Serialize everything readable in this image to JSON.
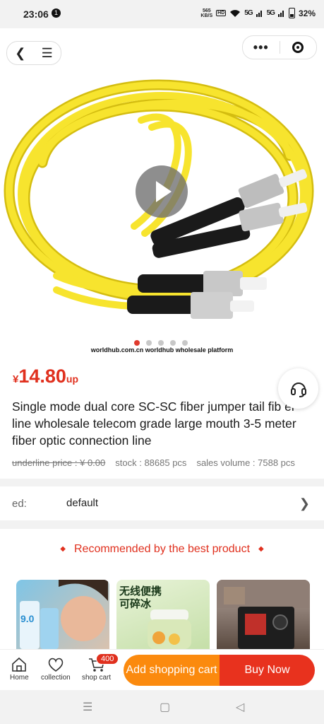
{
  "status_bar": {
    "time": "23:06",
    "notification_count": "1",
    "net_speed_value": "565",
    "net_speed_unit": "KB/S",
    "hd": "HD",
    "signal1": "5G",
    "signal2": "5G",
    "battery": "32%"
  },
  "product": {
    "currency": "¥",
    "price": "14.80",
    "price_suffix": "up",
    "title": "Single mode dual core SC-SC fiber jumper tail fib er line wholesale telecom grade large mouth 3-5 meter fiber optic connection line",
    "underline_price": "underline price : ¥ 0.00",
    "stock": "stock : 88685 pcs",
    "sales": "sales volume : 7588 pcs",
    "watermark": "worldhub.com.cn worldhub wholesale platform",
    "carousel_count": 5,
    "carousel_active": 1
  },
  "spec": {
    "label": "ed:",
    "value": "default"
  },
  "recommend": {
    "heading": "Recommended by the best product",
    "card2_line1": "无线便携",
    "card2_line2": "可碎冰",
    "card1_text": "9.0"
  },
  "bottom_bar": {
    "home_label": "Home",
    "collection_label": "collection",
    "cart_label": "shop cart",
    "cart_badge": "400",
    "add_cart_label": "Add shopping cart",
    "buy_now_label": "Buy Now"
  },
  "colors": {
    "accent": "#e0301e",
    "orange": "#fb8a0e",
    "cable": "#f5e02a"
  }
}
